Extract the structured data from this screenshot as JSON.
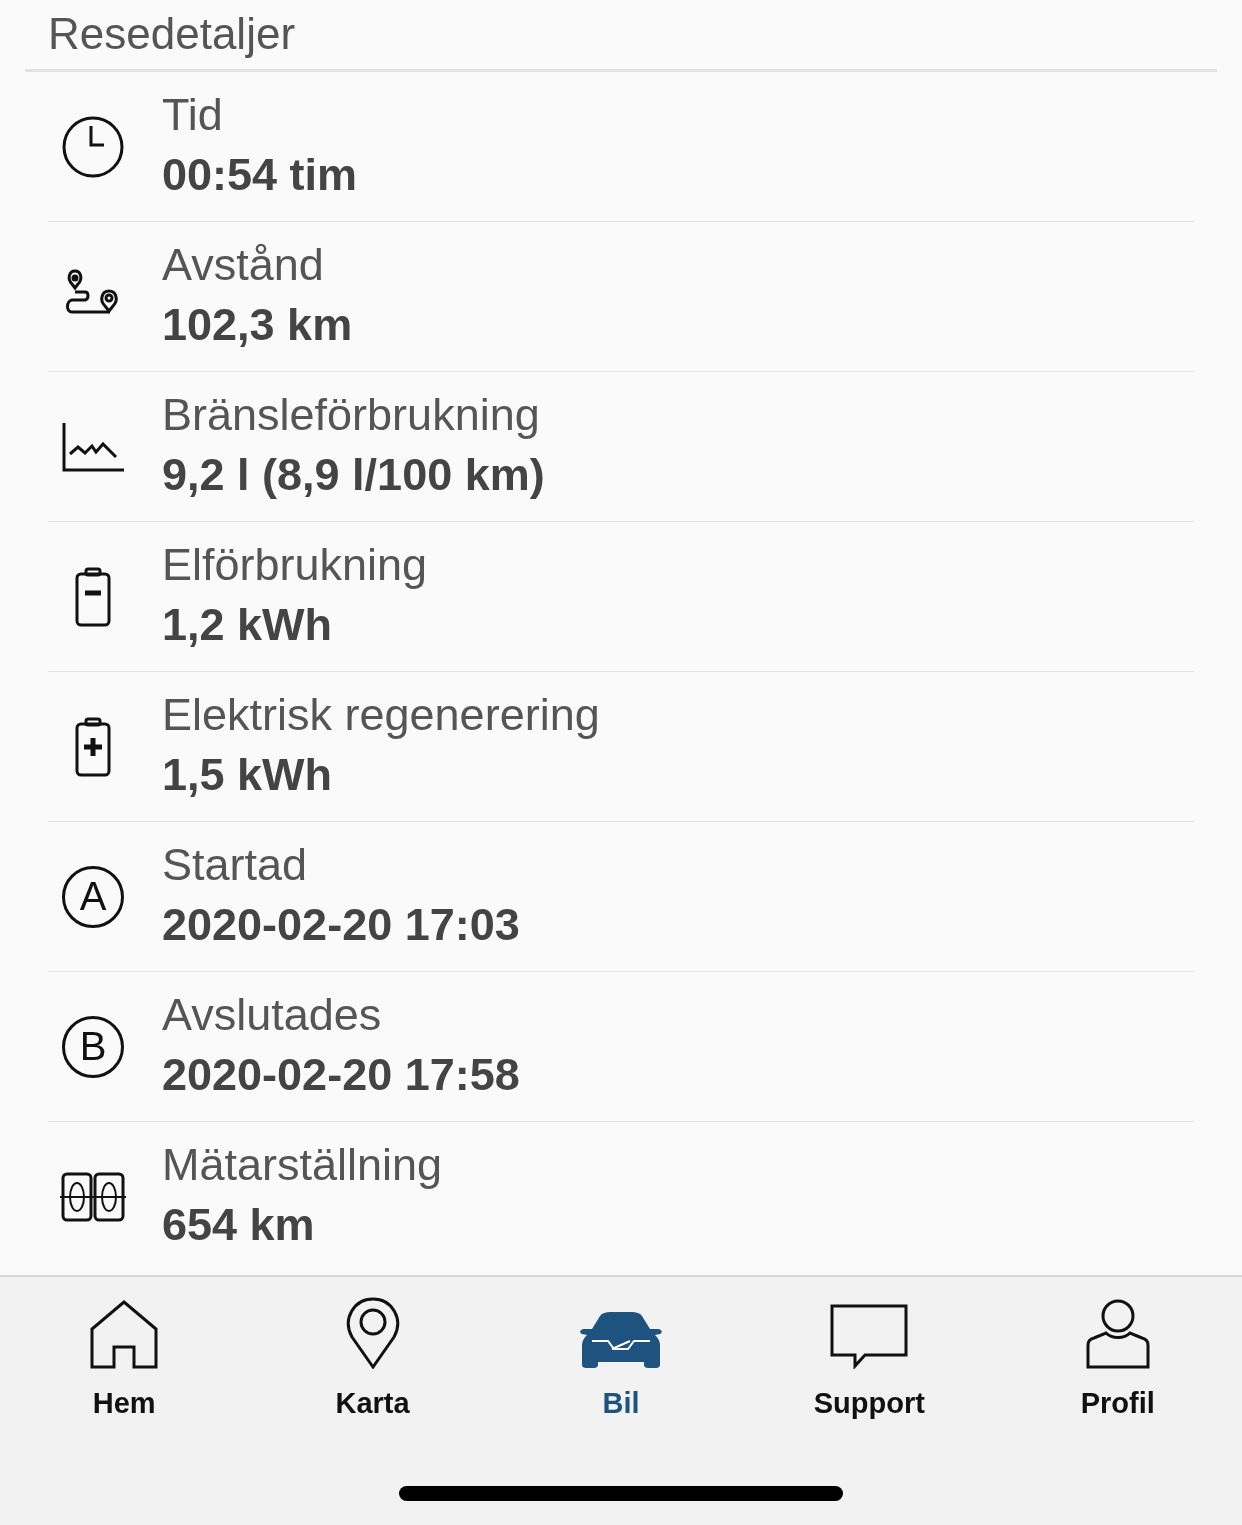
{
  "header": {
    "title": "Resedetaljer"
  },
  "details": [
    {
      "kind": "clock",
      "label": "Tid",
      "value": "00:54 tim"
    },
    {
      "kind": "route",
      "label": "Avstånd",
      "value": "102,3 km"
    },
    {
      "kind": "chart",
      "label": "Bränsleförbrukning",
      "value": "9,2 l (8,9 l/100 km)"
    },
    {
      "kind": "battery-minus",
      "label": "Elförbrukning",
      "value": "1,2 kWh"
    },
    {
      "kind": "battery-plus",
      "label": "Elektrisk regenerering",
      "value": "1,5 kWh"
    },
    {
      "kind": "letter",
      "badge": "A",
      "label": "Startad",
      "value": "2020-02-20 17:03"
    },
    {
      "kind": "letter",
      "badge": "B",
      "label": "Avslutades",
      "value": "2020-02-20 17:58"
    },
    {
      "kind": "odometer",
      "label": "Mätarställning",
      "value": "654 km"
    }
  ],
  "tab_bar": [
    {
      "kind": "home",
      "label": "Hem",
      "selected": false
    },
    {
      "kind": "map",
      "label": "Karta",
      "selected": false
    },
    {
      "kind": "car",
      "label": "Bil",
      "selected": true
    },
    {
      "kind": "chat",
      "label": "Support",
      "selected": false
    },
    {
      "kind": "person",
      "label": "Profil",
      "selected": false
    }
  ]
}
